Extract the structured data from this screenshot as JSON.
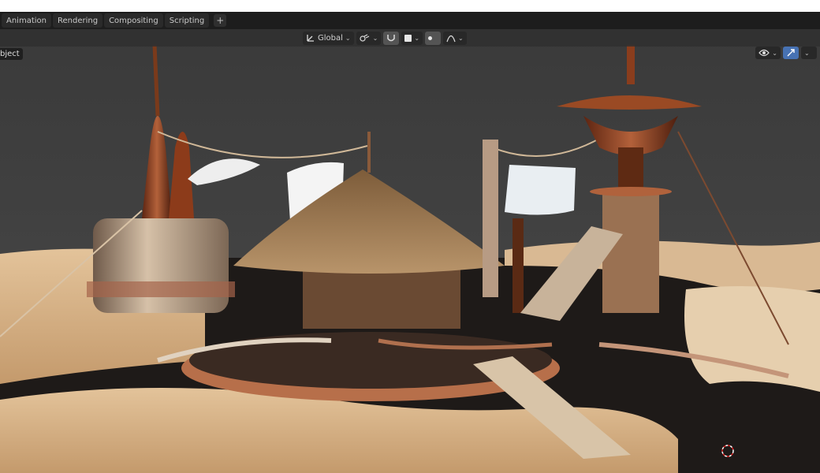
{
  "workspace_tabs": [
    {
      "label": "Animation"
    },
    {
      "label": "Rendering"
    },
    {
      "label": "Compositing"
    },
    {
      "label": "Scripting"
    }
  ],
  "add_tab_label": "+",
  "viewport_header": {
    "transform_orientation": "Global",
    "transform_icon": "orientation-icon",
    "pivot_icon": "link-icon",
    "snap_icon": "magnet-icon",
    "proportional_icon": "falloff-icon"
  },
  "interaction_mode": "bject",
  "right_tools": {
    "visibility_icon": "eye-icon",
    "gizmo_icon": "gizmo-icon"
  },
  "colors": {
    "tabbar_bg": "#1d1d1d",
    "active_blue": "#4772b3",
    "background_gray": "#3d3d3d",
    "sand": "#d9b48a",
    "copper": "#8a3f1f",
    "thatch": "#9e7b55"
  }
}
